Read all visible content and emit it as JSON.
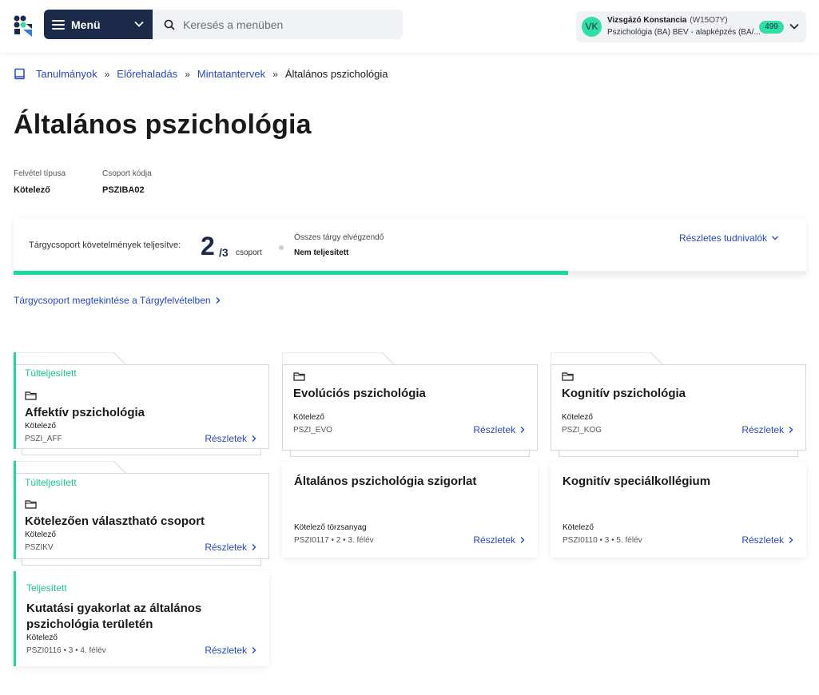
{
  "header": {
    "menu_label": "Menü",
    "search_placeholder": "Keresés a menüben",
    "user": {
      "initials": "VK",
      "name": "Vizsgázó Konstancia",
      "code": "(W15O7Y)",
      "program": "Pszichológia (BA) BÉV - alapképzés (BA/...",
      "badge": "499"
    }
  },
  "breadcrumb": {
    "items": [
      "Tanulmányok",
      "Előrehaladás",
      "Mintatantervek"
    ],
    "separator": "»",
    "current": "Általános pszichológia"
  },
  "page": {
    "title": "Általános pszichológia",
    "admission_type_label": "Felvétel típusa",
    "admission_type_value": "Kötelező",
    "group_code_label": "Csoport kódja",
    "group_code_value": "PSZIBA02"
  },
  "progress": {
    "label": "Tárgycsoport követelmények teljesítve:",
    "completed": "2",
    "total_label": "/3",
    "completed_fraction": 0.7,
    "unit": "csoport",
    "all_subjects_label": "Összes tárgy elvégzendő",
    "all_subjects_value": "Nem teljesített",
    "details_link": "Részletes tudnivalók",
    "accent_color": "#19d9a0"
  },
  "view_link": "Tárgycsoport megtekintése a Tárgyfelvételben",
  "cards": [
    {
      "status": "Túlteljesített",
      "title": "Affektív pszichológia",
      "type": "Kötelező",
      "code": "PSZI_AFF",
      "details": "Részletek"
    },
    {
      "status": "",
      "title": "Evolúciós pszichológia",
      "type": "Kötelező",
      "code": "PSZI_EVO",
      "details": "Részletek"
    },
    {
      "status": "",
      "title": "Kognitív pszichológia",
      "type": "Kötelező",
      "code": "PSZI_KOG",
      "details": "Részletek"
    },
    {
      "status": "Túlteljesített",
      "title": "Kötelezően választható csoport",
      "type": "Kötelező",
      "code": "PSZIKV",
      "details": "Részletek"
    },
    {
      "status": "",
      "title": "Általános pszichológia szigorlat",
      "type": "Kötelező törzsanyag",
      "code": "PSZI0117 • 2 • 3. félév",
      "details": "Részletek"
    },
    {
      "status": "",
      "title": "Kognitív speciálkollégium",
      "type": "Kötelező",
      "code": "PSZI0110 • 3 • 5. félév",
      "details": "Részletek"
    },
    {
      "status": "Teljesített",
      "title": "Kutatási gyakorlat az általános pszichológia területén",
      "type": "Kötelező",
      "code": "PSZI0116 • 3 • 4. félév",
      "details": "Részletek"
    }
  ]
}
